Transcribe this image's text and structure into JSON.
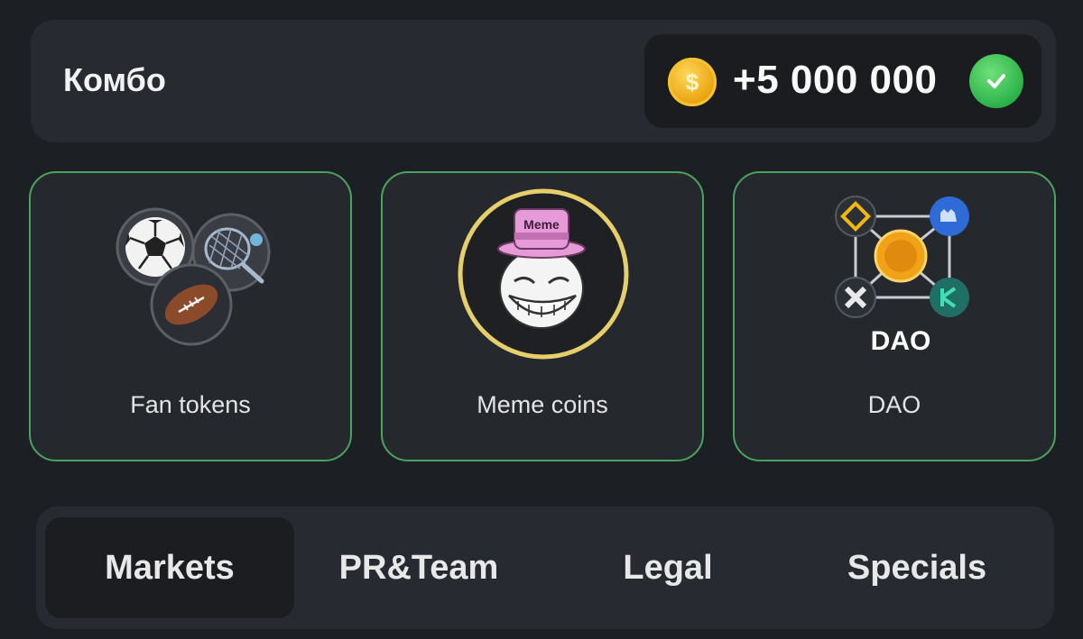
{
  "combo": {
    "title": "Комбо",
    "reward": "+5 000 000",
    "coin_symbol": "$",
    "coin_icon": "gold-coin-icon",
    "status_icon": "green-check-icon"
  },
  "cards": [
    {
      "label": "Fan tokens",
      "icon": "sports-balls-icon"
    },
    {
      "label": "Meme coins",
      "icon": "trollface-meme-icon",
      "hat_text": "Meme"
    },
    {
      "label": "DAO",
      "icon": "dao-network-icon",
      "art_text": "DAO"
    }
  ],
  "tabs": [
    {
      "label": "Markets",
      "active": true
    },
    {
      "label": "PR&Team",
      "active": false
    },
    {
      "label": "Legal",
      "active": false
    },
    {
      "label": "Specials",
      "active": false
    }
  ],
  "colors": {
    "background": "#1c1f24",
    "panel": "#272a30",
    "card_border": "#4aa25c",
    "coin": "#f0b319",
    "check": "#2cb24a"
  }
}
